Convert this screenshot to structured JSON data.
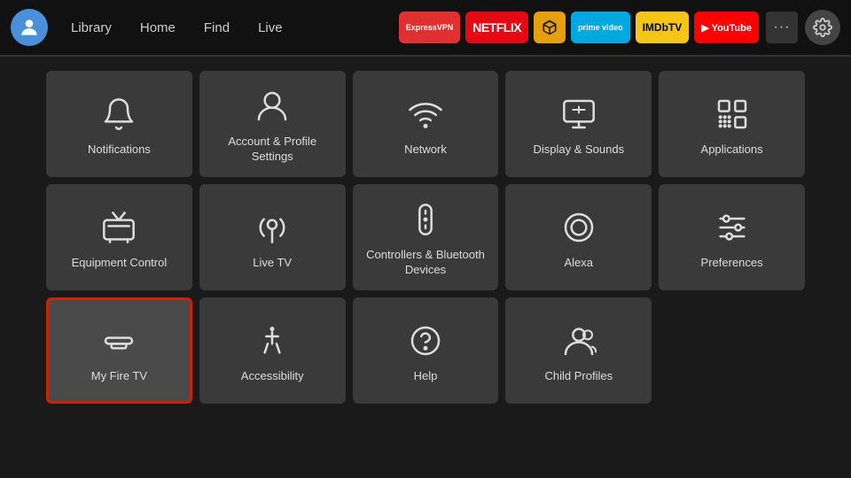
{
  "nav": {
    "links": [
      "Library",
      "Home",
      "Find",
      "Live"
    ],
    "apps": [
      {
        "id": "expressvpn",
        "label": "ExpressVPN",
        "class": "app-expressvpn"
      },
      {
        "id": "netflix",
        "label": "NETFLIX",
        "class": "app-netflix"
      },
      {
        "id": "plex",
        "label": "▶",
        "class": "app-plex"
      },
      {
        "id": "prime",
        "label": "prime video",
        "class": "app-prime"
      },
      {
        "id": "imdb",
        "label": "IMDbTV",
        "class": "app-imdb"
      },
      {
        "id": "youtube",
        "label": "▶ YouTube",
        "class": "app-youtube"
      }
    ],
    "more_label": "···",
    "settings_label": "Settings"
  },
  "settings": {
    "tiles": [
      {
        "id": "notifications",
        "label": "Notifications",
        "icon": "bell"
      },
      {
        "id": "account",
        "label": "Account & Profile Settings",
        "icon": "person"
      },
      {
        "id": "network",
        "label": "Network",
        "icon": "wifi"
      },
      {
        "id": "display",
        "label": "Display & Sounds",
        "icon": "display"
      },
      {
        "id": "applications",
        "label": "Applications",
        "icon": "apps"
      },
      {
        "id": "equipment",
        "label": "Equipment Control",
        "icon": "tv"
      },
      {
        "id": "livetv",
        "label": "Live TV",
        "icon": "antenna"
      },
      {
        "id": "controllers",
        "label": "Controllers & Bluetooth Devices",
        "icon": "remote"
      },
      {
        "id": "alexa",
        "label": "Alexa",
        "icon": "alexa"
      },
      {
        "id": "preferences",
        "label": "Preferences",
        "icon": "sliders"
      },
      {
        "id": "myfiretv",
        "label": "My Fire TV",
        "icon": "firetv",
        "selected": true
      },
      {
        "id": "accessibility",
        "label": "Accessibility",
        "icon": "accessibility"
      },
      {
        "id": "help",
        "label": "Help",
        "icon": "help"
      },
      {
        "id": "childprofiles",
        "label": "Child Profiles",
        "icon": "childprofiles"
      }
    ]
  }
}
